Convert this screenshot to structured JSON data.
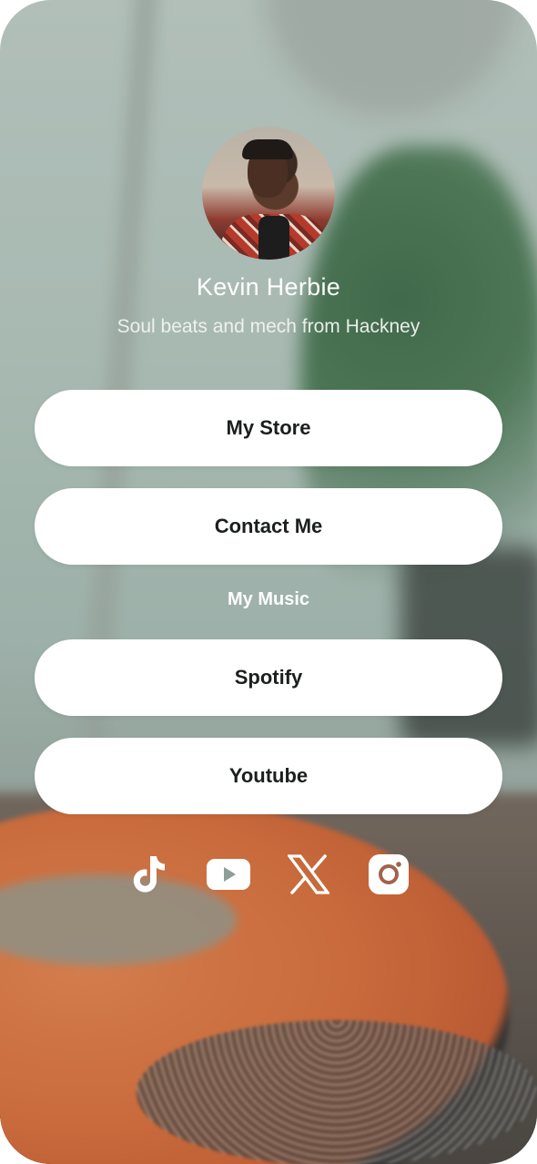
{
  "profile": {
    "name": "Kevin Herbie",
    "bio": "Soul beats and mech from Hackney"
  },
  "links": [
    {
      "label": "My Store"
    },
    {
      "label": "Contact Me"
    }
  ],
  "music_section": {
    "title": "My Music",
    "links": [
      {
        "label": "Spotify"
      },
      {
        "label": "Youtube"
      }
    ]
  },
  "social_icons": [
    "tiktok-icon",
    "youtube-icon",
    "x-icon",
    "instagram-icon"
  ],
  "colors": {
    "button_bg": "#ffffff",
    "button_text": "#1b1f1d",
    "text_light": "#ffffff"
  }
}
